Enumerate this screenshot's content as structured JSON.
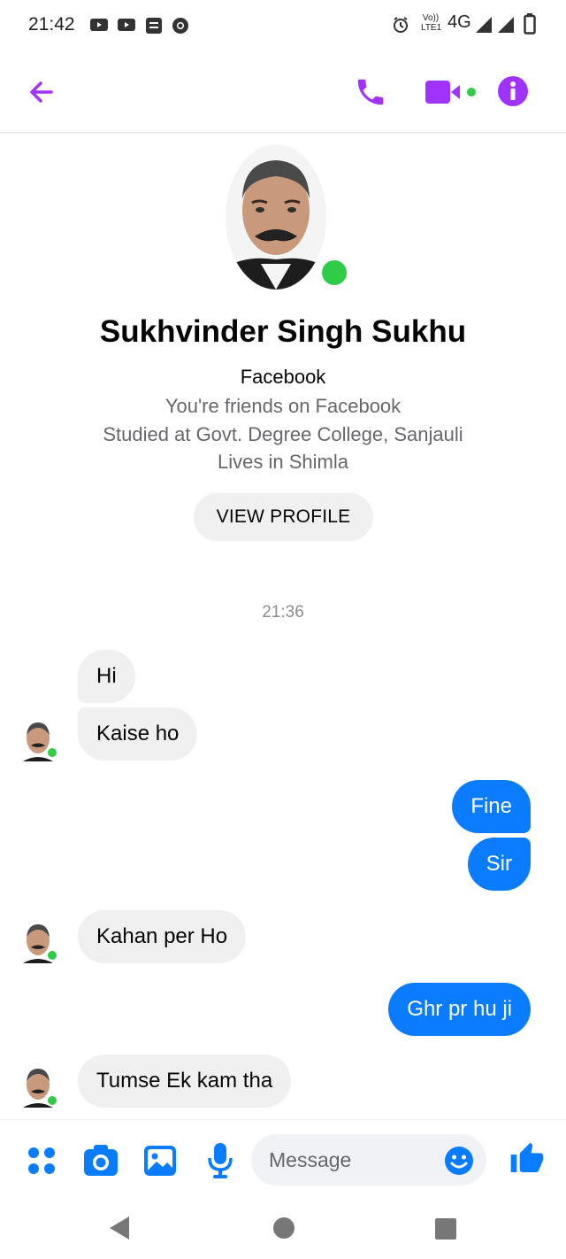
{
  "status_bar": {
    "time": "21:42",
    "network": "4G",
    "volte": "Vo)) LTE1",
    "left_icons": [
      "youtube-icon",
      "youtube-icon",
      "sim-icon",
      "chrome-icon"
    ],
    "right_icons": [
      "alarm-icon",
      "signal-icon",
      "signal-icon",
      "battery-icon"
    ]
  },
  "header": {
    "icons": [
      "back-arrow-icon",
      "phone-icon",
      "video-camera-icon",
      "info-icon"
    ],
    "accent": "#a033ff"
  },
  "profile": {
    "name": "Sukhvinder Singh Sukhu",
    "source": "Facebook",
    "friends": "You're friends on Facebook",
    "education": "Studied at Govt. Degree College, Sanjauli",
    "location": "Lives in Shimla",
    "view_profile_label": "VIEW PROFILE",
    "online_color": "#31cc46"
  },
  "conversation": {
    "timestamp": "21:36",
    "messages": [
      {
        "from": "them",
        "text": "Hi"
      },
      {
        "from": "them",
        "text": "Kaise ho"
      },
      {
        "from": "me",
        "text": "Fine"
      },
      {
        "from": "me",
        "text": "Sir"
      },
      {
        "from": "them",
        "text": "Kahan per Ho"
      },
      {
        "from": "me",
        "text": "Ghr pr hu ji"
      },
      {
        "from": "them",
        "text": "Tumse Ek kam tha"
      }
    ],
    "outgoing_color": "#0a7cff",
    "incoming_color": "#f0f0f0"
  },
  "composer": {
    "placeholder": "Message",
    "icons": [
      "apps-grid-icon",
      "camera-icon",
      "gallery-icon",
      "microphone-icon",
      "emoji-icon",
      "thumbs-up-icon"
    ],
    "accent": "#0a7cff"
  },
  "nav_bar": {
    "icons": [
      "nav-back-icon",
      "nav-home-icon",
      "nav-recents-icon"
    ]
  }
}
